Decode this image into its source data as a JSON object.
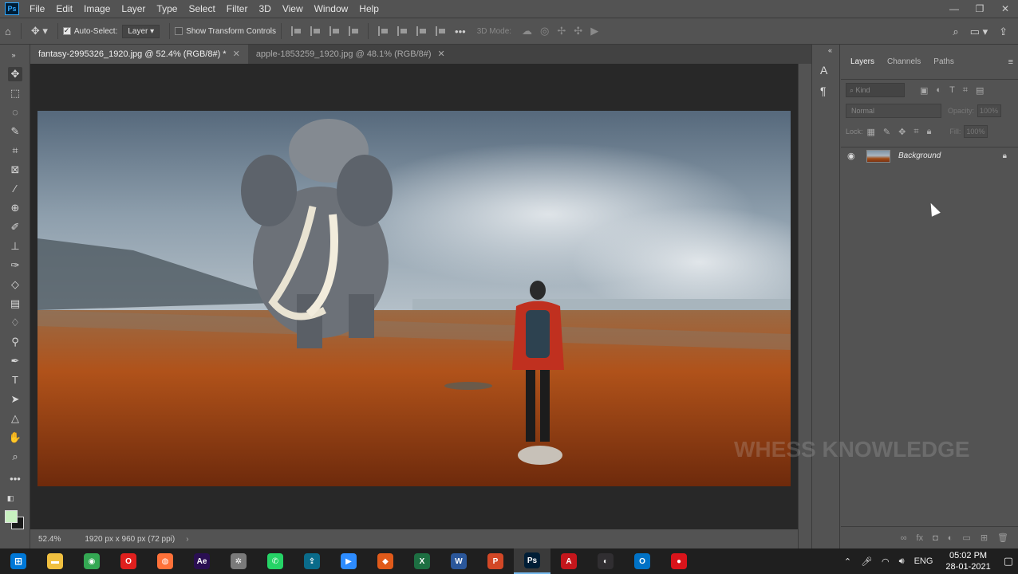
{
  "menu": {
    "logo": "Ps",
    "items": [
      "File",
      "Edit",
      "Image",
      "Layer",
      "Type",
      "Select",
      "Filter",
      "3D",
      "View",
      "Window",
      "Help"
    ]
  },
  "window_controls": {
    "minimize": "—",
    "restore": "❐",
    "close": "✕"
  },
  "options": {
    "auto_select_label": "Auto-Select:",
    "auto_select_checked": true,
    "target_value": "Layer",
    "show_transform_label": "Show Transform Controls",
    "show_transform_checked": false,
    "more": "•••",
    "mode_3d_label": "3D Mode:"
  },
  "tabs": [
    {
      "label": "fantasy-2995326_1920.jpg @ 52.4% (RGB/8#) *",
      "active": true
    },
    {
      "label": "apple-1853259_1920.jpg @ 48.1% (RGB/8#)",
      "active": false
    }
  ],
  "status": {
    "zoom": "52.4%",
    "doc_info": "1920 px x 960 px (72 ppi)",
    "arrow": "›"
  },
  "layers_panel": {
    "tabs": [
      "Layers",
      "Channels",
      "Paths"
    ],
    "active_tab": "Layers",
    "filter_placeholder": "Kind",
    "blend_mode": "Normal",
    "opacity_label": "Opacity:",
    "opacity_value": "100%",
    "lock_label": "Lock:",
    "fill_label": "Fill:",
    "fill_value": "100%",
    "layers": [
      {
        "name": "Background",
        "visible": true,
        "locked": true
      }
    ]
  },
  "watermark": "WHESS KNOWLEDGE",
  "taskbar": {
    "apps": [
      {
        "name": "file-explorer",
        "glyph": "▬",
        "color": "#f0c040"
      },
      {
        "name": "chrome",
        "glyph": "◉",
        "color": "#34a853"
      },
      {
        "name": "opera",
        "glyph": "O",
        "color": "#e0201e"
      },
      {
        "name": "firefox",
        "glyph": "◍",
        "color": "#ff7139"
      },
      {
        "name": "after-effects",
        "glyph": "Ae",
        "color": "#2a0f52"
      },
      {
        "name": "settings-app",
        "glyph": "✲",
        "color": "#7a7a7a"
      },
      {
        "name": "whatsapp",
        "glyph": "✆",
        "color": "#25d366"
      },
      {
        "name": "premiere-share",
        "glyph": "⇪",
        "color": "#0a6b8a"
      },
      {
        "name": "zoom",
        "glyph": "▶",
        "color": "#2d8cff"
      },
      {
        "name": "media-app",
        "glyph": "◆",
        "color": "#e05a1a"
      },
      {
        "name": "excel",
        "glyph": "X",
        "color": "#1d6f42"
      },
      {
        "name": "word",
        "glyph": "W",
        "color": "#2b579a"
      },
      {
        "name": "powerpoint",
        "glyph": "P",
        "color": "#d24726"
      },
      {
        "name": "photoshop",
        "glyph": "Ps",
        "color": "#001e36"
      },
      {
        "name": "acrobat",
        "glyph": "A",
        "color": "#c4161c"
      },
      {
        "name": "obs",
        "glyph": "◐",
        "color": "#302e31"
      },
      {
        "name": "outlook",
        "glyph": "O",
        "color": "#0072c6"
      },
      {
        "name": "recorder",
        "glyph": "●",
        "color": "#d9141b"
      }
    ],
    "active_app": "photoshop",
    "language": "ENG",
    "time": "05:02 PM",
    "date": "28-01-2021"
  }
}
